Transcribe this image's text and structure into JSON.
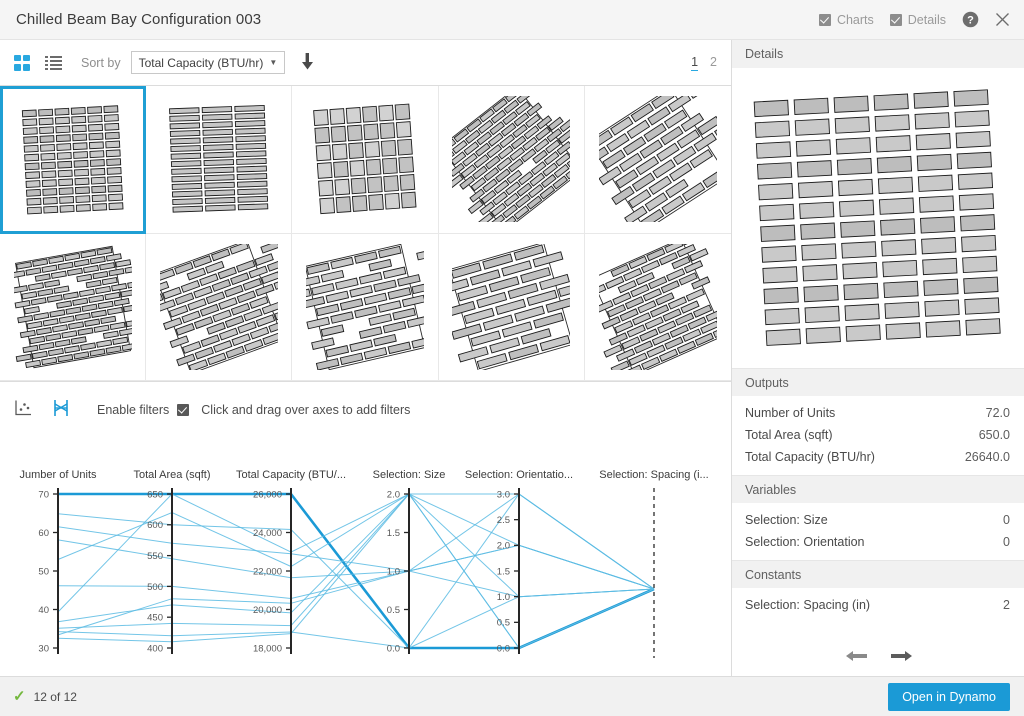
{
  "header": {
    "title": "Chilled Beam Bay Configuration 003",
    "charts_label": "Charts",
    "details_label": "Details",
    "charts_checked": true,
    "details_checked": true,
    "help_icon": "help-circle-icon",
    "close_icon": "close-icon"
  },
  "toolbar": {
    "grid_view_icon": "grid-view-icon",
    "list_view_icon": "list-view-icon",
    "sort_by_label": "Sort by",
    "sort_value": "Total Capacity (BTU/hr)",
    "sort_caret": "▼",
    "sort_direction_icon": "arrow-down-icon",
    "sort_direction_glyph": "⬇",
    "pages": [
      "1",
      "2"
    ],
    "active_page": "1"
  },
  "chart_toolbar": {
    "scatter_icon": "scatter-plot-icon",
    "parallel_icon": "parallel-coordinates-icon",
    "enable_filters_label": "Enable filters",
    "enable_filters_checked": true,
    "hint": "Click and drag over axes to add filters"
  },
  "thumbnails": [
    {
      "name": "option-1",
      "selected": true,
      "layout": "columns",
      "rot": -3
    },
    {
      "name": "option-2",
      "selected": false,
      "layout": "wide-columns",
      "rot": -2
    },
    {
      "name": "option-3",
      "selected": false,
      "layout": "squares",
      "rot": -4
    },
    {
      "name": "option-4",
      "selected": false,
      "layout": "brick-diagonal",
      "rot": -38
    },
    {
      "name": "option-5",
      "selected": false,
      "layout": "brick-sparse",
      "rot": -33
    },
    {
      "name": "option-6",
      "selected": false,
      "layout": "brick-dense",
      "rot": -10
    },
    {
      "name": "option-7",
      "selected": false,
      "layout": "brick-diag2",
      "rot": -20
    },
    {
      "name": "option-8",
      "selected": false,
      "layout": "brick-wide",
      "rot": -13
    },
    {
      "name": "option-9",
      "selected": false,
      "layout": "brick-long",
      "rot": -16
    },
    {
      "name": "option-10",
      "selected": false,
      "layout": "basket",
      "rot": -24
    }
  ],
  "details": {
    "panel_title": "Details",
    "preview_name": "selected-option-preview",
    "outputs_title": "Outputs",
    "outputs": [
      {
        "label": "Number of Units",
        "value": "72.0"
      },
      {
        "label": "Total Area (sqft)",
        "value": "650.0"
      },
      {
        "label": "Total Capacity (BTU/hr)",
        "value": "26640.0"
      }
    ],
    "variables_title": "Variables",
    "variables": [
      {
        "label": "Selection: Size",
        "value": "0"
      },
      {
        "label": "Selection: Orientation",
        "value": "0"
      }
    ],
    "constants_title": "Constants",
    "constants": [
      {
        "label": "Selection: Spacing (in)",
        "value": "2"
      }
    ],
    "prev_icon": "arrow-left-icon",
    "prev_glyph": "⬅",
    "next_icon": "arrow-right-icon",
    "next_glyph": "➡"
  },
  "status": {
    "check_icon": "checkmark-icon",
    "check_glyph": "✓",
    "count_text": "12 of 12",
    "primary_button": "Open in Dynamo"
  },
  "chart_data": {
    "type": "line",
    "subtype": "parallel-coordinates",
    "title": "",
    "grid": false,
    "legend": false,
    "accent_color": "#1b9ad6",
    "line_color": "#5bbbe3",
    "highlight_color": "#1b9ad6",
    "axes": [
      {
        "label": "Number of Units",
        "label_clipped": "Jumber of Units",
        "ticks": [
          "30",
          "40",
          "50",
          "60",
          "70"
        ],
        "range": [
          25,
          72
        ],
        "kind": "variable"
      },
      {
        "label": "Total Area (sqft)",
        "ticks": [
          "400",
          "450",
          "500",
          "550",
          "600",
          "650"
        ],
        "range": [
          400,
          650
        ],
        "kind": "variable"
      },
      {
        "label": "Total Capacity (BTU/...",
        "label_full": "Total Capacity (BTU/hr)",
        "ticks": [
          "18,000",
          "20,000",
          "22,000",
          "24,000",
          "26,000"
        ],
        "range": [
          17000,
          26640
        ],
        "kind": "variable"
      },
      {
        "label": "Selection: Size",
        "ticks": [
          "0.0",
          "0.5",
          "1.0",
          "1.5",
          "2.0"
        ],
        "range": [
          0,
          2
        ],
        "kind": "variable"
      },
      {
        "label": "Selection: Orientatio...",
        "label_full": "Selection: Orientation",
        "ticks": [
          "0.0",
          "0.5",
          "1.0",
          "1.5",
          "2.0",
          "2.5",
          "3.0"
        ],
        "range": [
          0,
          3
        ],
        "kind": "variable"
      },
      {
        "label": "Selection: Spacing (i...",
        "label_full": "Selection: Spacing (in)",
        "ticks": [],
        "range": [
          2,
          2
        ],
        "kind": "constant",
        "style": "dashed"
      }
    ],
    "series": [
      {
        "name": "option-1",
        "highlighted": true,
        "values": [
          72,
          650,
          26640,
          0,
          0,
          2
        ]
      },
      {
        "name": "option-2",
        "highlighted": false,
        "values": [
          66,
          600,
          24420,
          0,
          1,
          2
        ]
      },
      {
        "name": "option-3",
        "highlighted": false,
        "values": [
          36,
          650,
          23000,
          2,
          0,
          2
        ]
      },
      {
        "name": "option-4",
        "highlighted": false,
        "values": [
          62,
          570,
          22900,
          1,
          2,
          2
        ]
      },
      {
        "name": "option-5",
        "highlighted": false,
        "values": [
          58,
          545,
          21400,
          1,
          3,
          2
        ]
      },
      {
        "name": "option-6",
        "highlighted": false,
        "values": [
          52,
          620,
          22100,
          2,
          1,
          2
        ]
      },
      {
        "name": "option-7",
        "highlighted": false,
        "values": [
          44,
          500,
          20100,
          1,
          2,
          2
        ]
      },
      {
        "name": "option-8",
        "highlighted": false,
        "values": [
          33,
          470,
          19200,
          2,
          3,
          2
        ]
      },
      {
        "name": "option-9",
        "highlighted": false,
        "values": [
          31,
          440,
          18400,
          2,
          2,
          2
        ]
      },
      {
        "name": "option-10",
        "highlighted": false,
        "values": [
          30,
          420,
          18000,
          0,
          3,
          2
        ]
      },
      {
        "name": "option-11",
        "highlighted": false,
        "values": [
          29,
          480,
          19800,
          1,
          1,
          2
        ]
      },
      {
        "name": "option-12",
        "highlighted": false,
        "values": [
          28,
          410,
          17900,
          2,
          0,
          2
        ]
      }
    ]
  }
}
